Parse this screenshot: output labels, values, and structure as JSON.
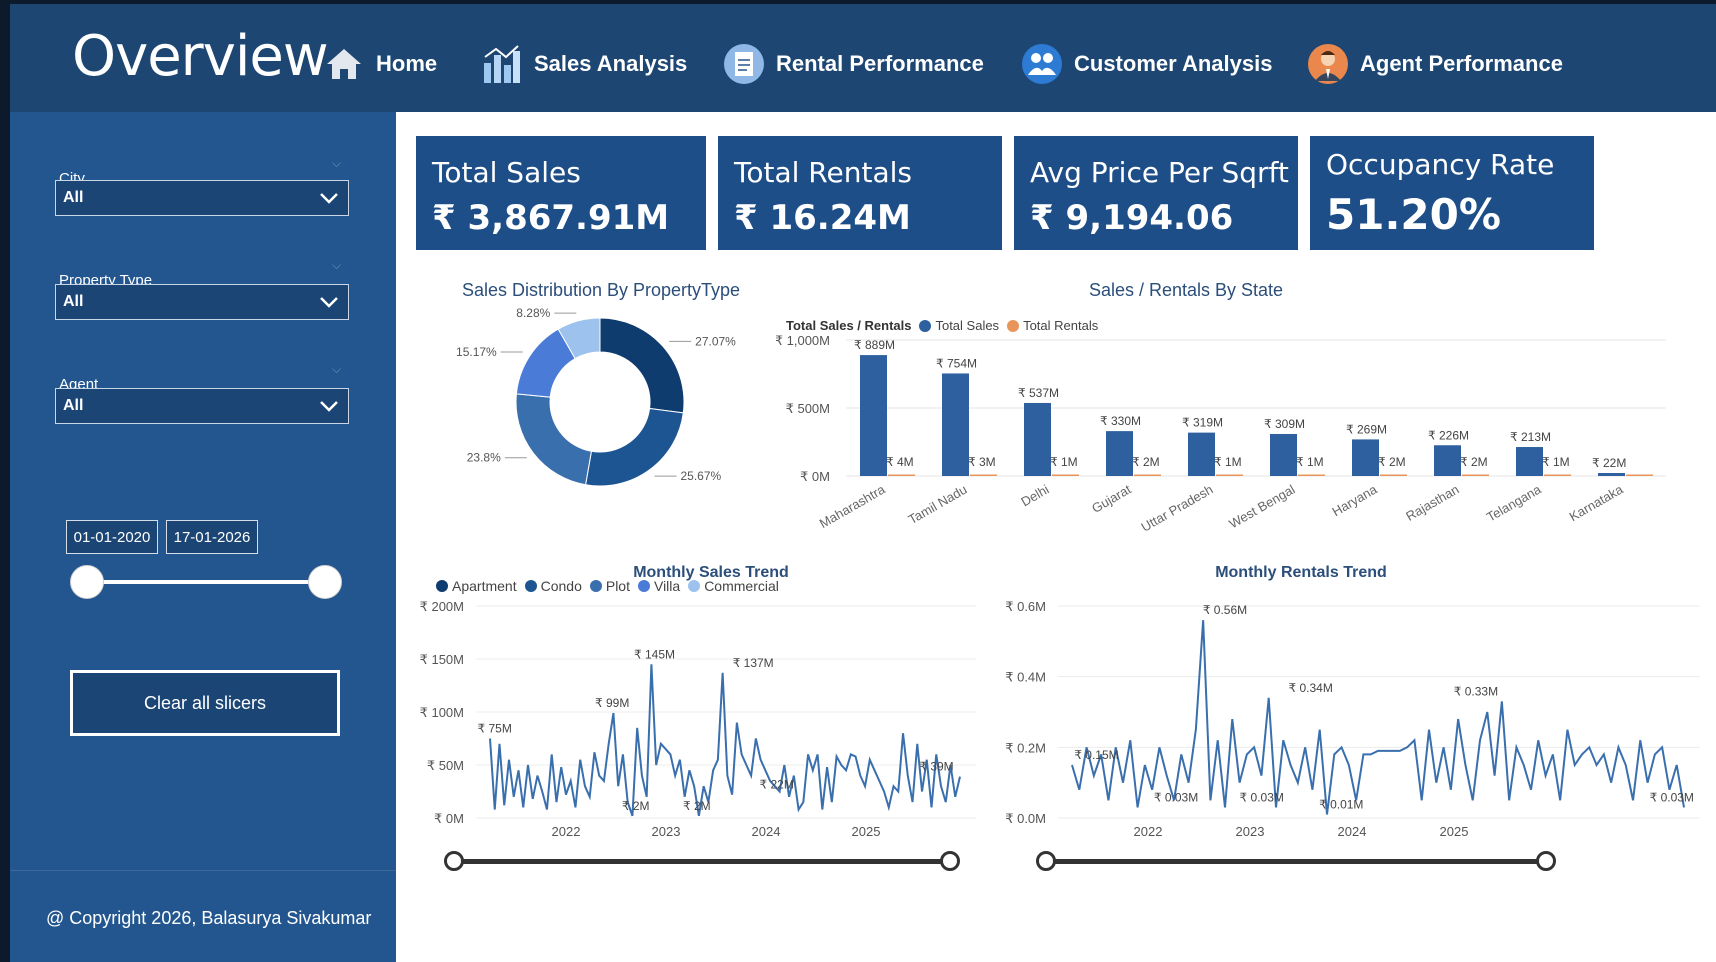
{
  "header": {
    "title": "Overview",
    "nav": [
      {
        "label": "Home",
        "icon": "home-icon"
      },
      {
        "label": "Sales Analysis",
        "icon": "bar-chart-icon"
      },
      {
        "label": "Rental Performance",
        "icon": "rent-document-icon"
      },
      {
        "label": "Customer Analysis",
        "icon": "customers-icon"
      },
      {
        "label": "Agent Performance",
        "icon": "agent-avatar-icon"
      }
    ]
  },
  "sidebar": {
    "slicers": [
      {
        "label": "City",
        "value": "All"
      },
      {
        "label": "Property Type",
        "value": "All"
      },
      {
        "label": "Agent",
        "value": "All"
      }
    ],
    "date_start": "01-01-2020",
    "date_end": "17-01-2026",
    "date_range_fraction": [
      0,
      1
    ],
    "clear_button": "Clear all slicers",
    "copyright": "@ Copyright 2026, Balasurya Sivakumar"
  },
  "kpis": [
    {
      "title": "Total Sales",
      "value": "₹ 3,867.91M"
    },
    {
      "title": "Total Rentals",
      "value": "₹ 16.24M"
    },
    {
      "title": "Avg Price Per Sqrft",
      "value": "₹ 9,194.06"
    },
    {
      "title": "Occupancy Rate",
      "value": "51.20%"
    }
  ],
  "colors": {
    "header_bg": "#1d4672",
    "sidebar_bg": "#23568f",
    "kpi_bg": "#1d4e88",
    "sales_series": "#2e5f9e",
    "rentals_series": "#e8945a",
    "line_series": "#3a6fae"
  },
  "chart_data": [
    {
      "type": "pie",
      "title": "Sales Distribution By PropertyType",
      "categories": [
        "Apartment",
        "Condo",
        "Plot",
        "Villa",
        "Commercial"
      ],
      "values": [
        27.07,
        25.67,
        23.8,
        15.17,
        8.28
      ],
      "labels": [
        "27.07%",
        "25.67%",
        "23.8%",
        "15.17%",
        "8.28%"
      ],
      "colors": [
        "#0f3c6e",
        "#1d5593",
        "#3a6fae",
        "#4a7bd6",
        "#9ec2ee"
      ],
      "legend": "bottom"
    },
    {
      "type": "bar",
      "title": "Sales / Rentals By State",
      "legend_title": "Total Sales / Rentals",
      "legend": "top-left",
      "categories": [
        "Maharashtra",
        "Tamil Nadu",
        "Delhi",
        "Gujarat",
        "Uttar Pradesh",
        "West Bengal",
        "Haryana",
        "Rajasthan",
        "Telangana",
        "Karnataka"
      ],
      "series": [
        {
          "name": "Total Sales",
          "values": [
            889,
            754,
            537,
            330,
            319,
            309,
            269,
            226,
            213,
            22
          ],
          "labels": [
            "₹ 889M",
            "₹ 754M",
            "₹ 537M",
            "₹ 330M",
            "₹ 319M",
            "₹ 309M",
            "₹ 269M",
            "₹ 226M",
            "₹ 213M",
            "₹ 22M"
          ]
        },
        {
          "name": "Total Rentals",
          "values": [
            4,
            3,
            1,
            2,
            1,
            1,
            2,
            2,
            1,
            0
          ],
          "labels": [
            "₹ 4M",
            "₹ 3M",
            "₹ 1M",
            "₹ 2M",
            "₹ 1M",
            "₹ 1M",
            "₹ 2M",
            "₹ 2M",
            "₹ 1M",
            ""
          ]
        }
      ],
      "yticks": [
        "₹ 0M",
        "₹ 500M",
        "₹ 1,000M"
      ],
      "ylim": [
        0,
        1000
      ],
      "grid": true
    },
    {
      "type": "line",
      "title": "Monthly Sales Trend",
      "x_ticks": [
        "2022",
        "2023",
        "2024",
        "2025"
      ],
      "y_ticks": [
        "₹ 0M",
        "₹ 50M",
        "₹ 100M",
        "₹ 150M",
        "₹ 200M"
      ],
      "ylim": [
        0,
        200
      ],
      "xlim": [
        "2021-01",
        "2025-12"
      ],
      "annotations": [
        {
          "text": "₹ 75M",
          "x": 2021.05,
          "y": 75
        },
        {
          "text": "₹ 99M",
          "x": 2022.3,
          "y": 99
        },
        {
          "text": "₹ 2M",
          "x": 2022.55,
          "y": 2
        },
        {
          "text": "₹ 145M",
          "x": 2022.75,
          "y": 145
        },
        {
          "text": "₹ 2M",
          "x": 2023.2,
          "y": 2
        },
        {
          "text": "₹ 137M",
          "x": 2023.8,
          "y": 137
        },
        {
          "text": "₹ 22M",
          "x": 2024.05,
          "y": 22
        },
        {
          "text": "₹ 39M",
          "x": 2025.75,
          "y": 39
        }
      ],
      "values": [
        75,
        8,
        70,
        12,
        55,
        20,
        45,
        10,
        50,
        18,
        40,
        25,
        8,
        60,
        15,
        48,
        22,
        35,
        10,
        55,
        30,
        20,
        62,
        40,
        35,
        70,
        99,
        30,
        60,
        15,
        2,
        85,
        40,
        20,
        145,
        50,
        70,
        65,
        60,
        40,
        55,
        20,
        45,
        30,
        2,
        30,
        15,
        45,
        55,
        137,
        40,
        22,
        90,
        60,
        50,
        40,
        75,
        55,
        45,
        35,
        30,
        25,
        50,
        20,
        40,
        8,
        15,
        60,
        45,
        60,
        8,
        48,
        15,
        58,
        50,
        45,
        60,
        58,
        40,
        30,
        55,
        45,
        35,
        25,
        10,
        30,
        25,
        80,
        40,
        15,
        70,
        25,
        55,
        10,
        60,
        30,
        15,
        50,
        20,
        39
      ],
      "range_fraction": [
        0,
        1
      ]
    },
    {
      "type": "line",
      "title": "Monthly Rentals Trend",
      "x_ticks": [
        "2022",
        "2023",
        "2024",
        "2025"
      ],
      "y_ticks": [
        "₹ 0.0M",
        "₹ 0.2M",
        "₹ 0.4M",
        "₹ 0.6M"
      ],
      "ylim": [
        0,
        0.6
      ],
      "xlim": [
        "2021-01",
        "2025-12"
      ],
      "annotations": [
        {
          "text": "₹ 0.15M",
          "x": 2021.2,
          "y": 0.15
        },
        {
          "text": "₹ 0.03M",
          "x": 2021.85,
          "y": 0.03
        },
        {
          "text": "₹ 0.56M",
          "x": 2022.25,
          "y": 0.56
        },
        {
          "text": "₹ 0.03M",
          "x": 2022.55,
          "y": 0.03
        },
        {
          "text": "₹ 0.34M",
          "x": 2022.95,
          "y": 0.34
        },
        {
          "text": "₹ 0.01M",
          "x": 2023.2,
          "y": 0.01
        },
        {
          "text": "₹ 0.33M",
          "x": 2024.3,
          "y": 0.33
        },
        {
          "text": "₹ 0.03M",
          "x": 2025.9,
          "y": 0.03
        }
      ],
      "values": [
        0.15,
        0.08,
        0.2,
        0.12,
        0.18,
        0.05,
        0.2,
        0.1,
        0.22,
        0.03,
        0.15,
        0.08,
        0.2,
        0.12,
        0.05,
        0.18,
        0.1,
        0.25,
        0.56,
        0.05,
        0.22,
        0.03,
        0.28,
        0.1,
        0.18,
        0.2,
        0.12,
        0.34,
        0.03,
        0.22,
        0.15,
        0.1,
        0.2,
        0.08,
        0.25,
        0.01,
        0.18,
        0.2,
        0.15,
        0.05,
        0.18,
        0.18,
        0.19,
        0.19,
        0.19,
        0.19,
        0.2,
        0.22,
        0.05,
        0.25,
        0.1,
        0.2,
        0.08,
        0.28,
        0.15,
        0.05,
        0.22,
        0.3,
        0.12,
        0.33,
        0.05,
        0.2,
        0.15,
        0.08,
        0.22,
        0.12,
        0.18,
        0.05,
        0.25,
        0.15,
        0.18,
        0.2,
        0.15,
        0.18,
        0.1,
        0.2,
        0.15,
        0.05,
        0.22,
        0.1,
        0.18,
        0.2,
        0.08,
        0.15,
        0.03
      ],
      "range_fraction": [
        0,
        1
      ]
    }
  ]
}
